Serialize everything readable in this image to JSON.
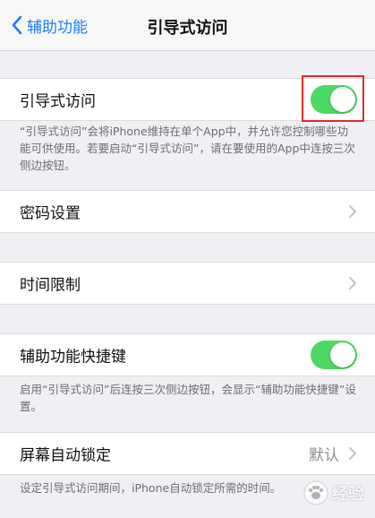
{
  "nav": {
    "back_label": "辅助功能",
    "title": "引导式访问"
  },
  "guided_access": {
    "label": "引导式访问",
    "enabled": true,
    "footnote": "“引导式访问”会将iPhone维持在单个App中，并允许您控制哪些功能可供使用。若要启动“引导式访问”，请在要使用的App中连按三次侧边按钮。"
  },
  "passcode": {
    "label": "密码设置"
  },
  "time_limits": {
    "label": "时间限制"
  },
  "accessibility_shortcut": {
    "label": "辅助功能快捷键",
    "enabled": true,
    "footnote": "启用“引导式访问”后连按三次侧边按钮，会显示“辅助功能快捷键”设置。"
  },
  "auto_lock": {
    "label": "屏幕自动锁定",
    "value": "默认",
    "footnote": "设定引导式访问期间，iPhone自动锁定所需的时间。"
  },
  "watermark": {
    "text": "经验"
  },
  "colors": {
    "accent": "#1f7cf3",
    "toggle_on": "#4cd964",
    "highlight": "#e02a2a"
  }
}
